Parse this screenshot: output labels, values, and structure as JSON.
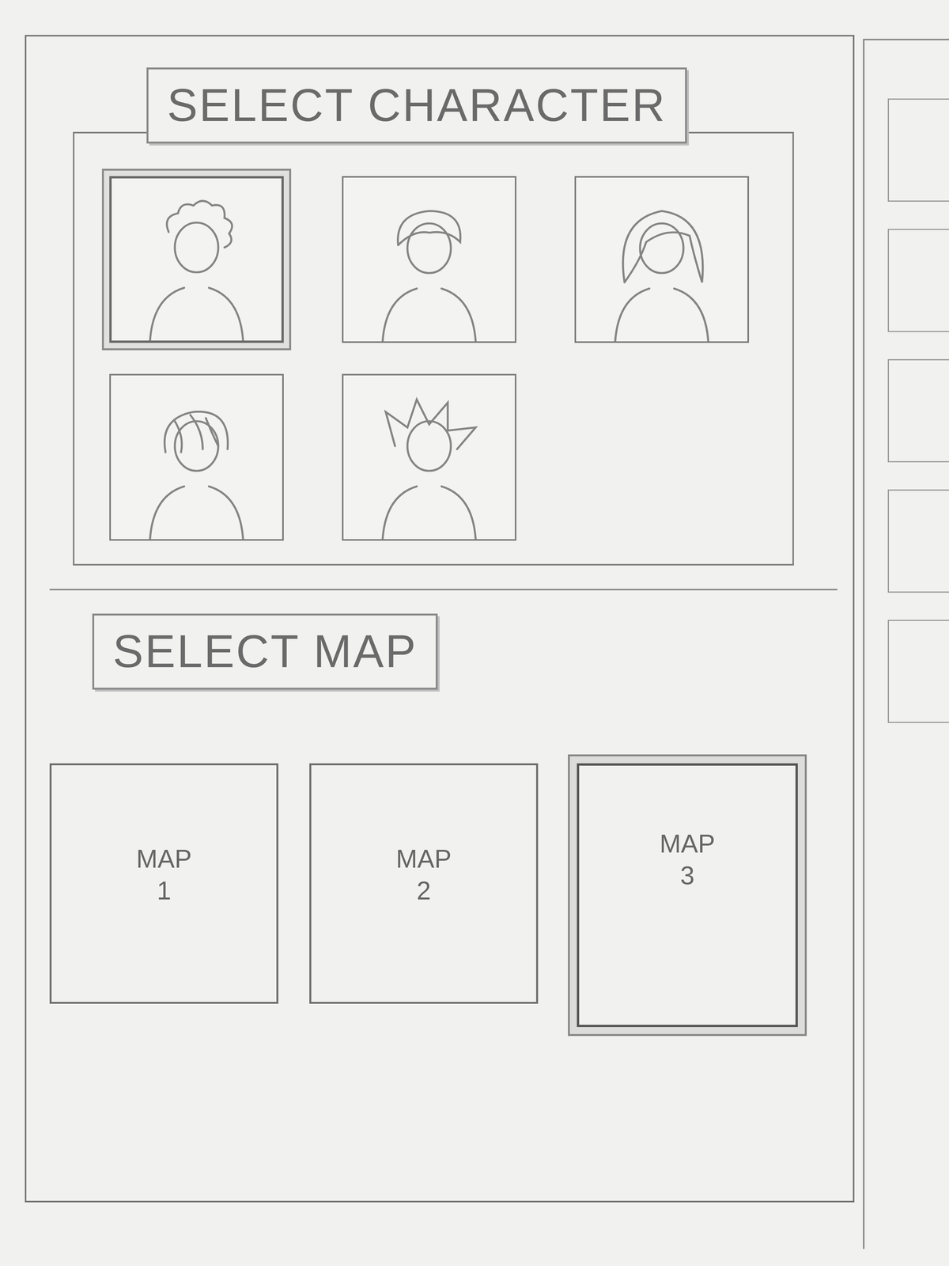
{
  "character_section": {
    "title": "SELECT CHARACTER",
    "characters": [
      {
        "kind": "curly",
        "selected": true
      },
      {
        "kind": "short",
        "selected": false
      },
      {
        "kind": "long",
        "selected": false
      },
      {
        "kind": "messy",
        "selected": false
      },
      {
        "kind": "spiky",
        "selected": false
      }
    ]
  },
  "map_section": {
    "title": "SELECT MAP",
    "maps": [
      {
        "label": "MAP",
        "number": "1",
        "selected": false
      },
      {
        "label": "MAP",
        "number": "2",
        "selected": false
      },
      {
        "label": "MAP",
        "number": "3",
        "selected": true
      }
    ]
  }
}
